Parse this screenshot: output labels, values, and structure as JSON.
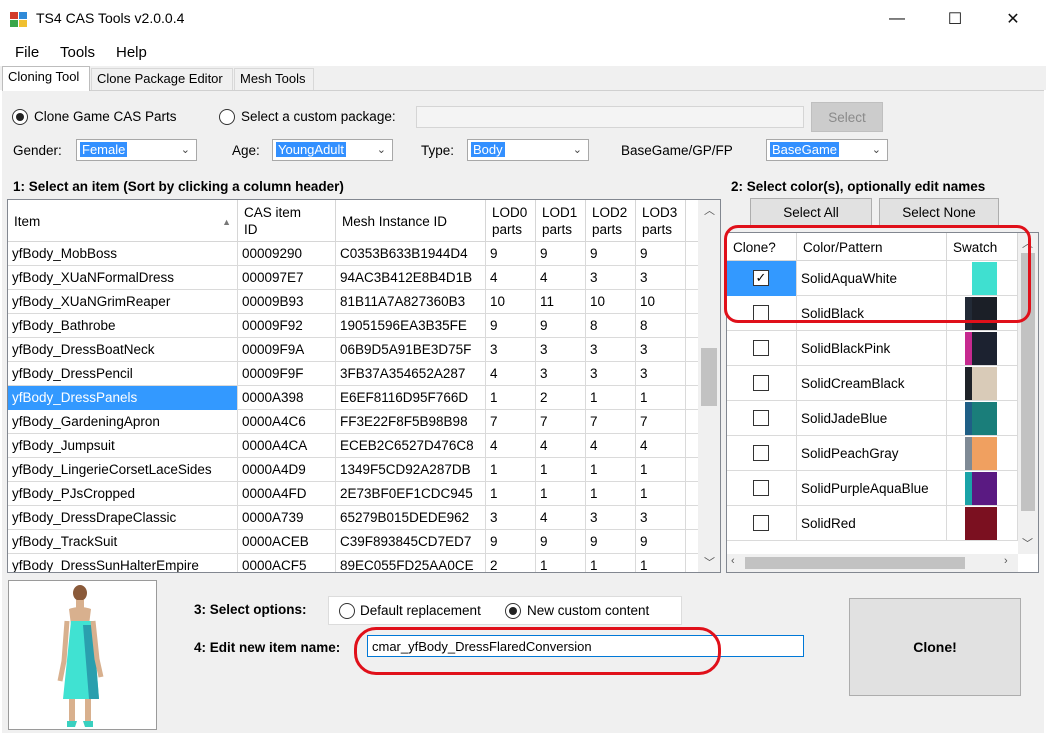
{
  "window": {
    "title": "TS4 CAS Tools v2.0.0.4",
    "minimize": "—",
    "maximize": "☐",
    "close": "✕"
  },
  "menu": {
    "file": "File",
    "tools": "Tools",
    "help": "Help"
  },
  "tabs": [
    "Cloning Tool",
    "Clone Package Editor",
    "Mesh Tools"
  ],
  "source": {
    "clone_game": "Clone Game CAS Parts",
    "custom_package": "Select a custom package:",
    "package_path": "",
    "select_btn": "Select"
  },
  "filters": {
    "gender_label": "Gender:",
    "gender": "Female",
    "age_label": "Age:",
    "age": "YoungAdult",
    "type_label": "Type:",
    "type": "Body",
    "pack_label": "BaseGame/GP/FP",
    "pack": "BaseGame"
  },
  "items": {
    "heading": "1: Select an item (Sort by clicking a column header)",
    "columns": {
      "item": "Item",
      "cas_1": "CAS item",
      "cas_2": "ID",
      "mesh": "Mesh Instance ID",
      "lod0a": "LOD0",
      "lod1a": "LOD1",
      "lod2a": "LOD2",
      "lod3a": "LOD3",
      "parts": "parts"
    },
    "rows": [
      [
        "yfBody_MobBoss",
        "00009290",
        "C0353B633B1944D4",
        "9",
        "9",
        "9",
        "9"
      ],
      [
        "yfBody_XUaNFormalDress",
        "000097E7",
        "94AC3B412E8B4D1B",
        "4",
        "4",
        "3",
        "3"
      ],
      [
        "yfBody_XUaNGrimReaper",
        "00009B93",
        "81B11A7A827360B3",
        "10",
        "11",
        "10",
        "10"
      ],
      [
        "yfBody_Bathrobe",
        "00009F92",
        "19051596EA3B35FE",
        "9",
        "9",
        "8",
        "8"
      ],
      [
        "yfBody_DressBoatNeck",
        "00009F9A",
        "06B9D5A91BE3D75F",
        "3",
        "3",
        "3",
        "3"
      ],
      [
        "yfBody_DressPencil",
        "00009F9F",
        "3FB37A354652A287",
        "4",
        "3",
        "3",
        "3"
      ],
      [
        "yfBody_DressPanels",
        "0000A398",
        "E6EF8116D95F766D",
        "1",
        "2",
        "1",
        "1"
      ],
      [
        "yfBody_GardeningApron",
        "0000A4C6",
        "FF3E22F8F5B98B98",
        "7",
        "7",
        "7",
        "7"
      ],
      [
        "yfBody_Jumpsuit",
        "0000A4CA",
        "ECEB2C6527D476C8",
        "4",
        "4",
        "4",
        "4"
      ],
      [
        "yfBody_LingerieCorsetLaceSides",
        "0000A4D9",
        "1349F5CD92A287DB",
        "1",
        "1",
        "1",
        "1"
      ],
      [
        "yfBody_PJsCropped",
        "0000A4FD",
        "2E73BF0EF1CDC945",
        "1",
        "1",
        "1",
        "1"
      ],
      [
        "yfBody_DressDrapeClassic",
        "0000A739",
        "65279B015DEDE962",
        "3",
        "4",
        "3",
        "3"
      ],
      [
        "yfBody_TrackSuit",
        "0000ACEB",
        "C39F893845CD7ED7",
        "9",
        "9",
        "9",
        "9"
      ],
      [
        "yfBody_DressSunHalterEmpire",
        "0000ACF5",
        "89EC055FD25AA0CE",
        "2",
        "1",
        "1",
        "1"
      ]
    ],
    "selected_index": 6
  },
  "colors": {
    "heading": "2: Select color(s), optionally edit names",
    "select_all": "Select All",
    "select_none": "Select None",
    "columns": {
      "clone": "Clone?",
      "pattern": "Color/Pattern",
      "swatch": "Swatch"
    },
    "rows": [
      {
        "checked": true,
        "name": "SolidAquaWhite",
        "swatch": [
          "#ffffff",
          "#3fe0d0"
        ]
      },
      {
        "checked": false,
        "name": "SolidBlack",
        "swatch": [
          "#222a36",
          "#1b1f27"
        ]
      },
      {
        "checked": false,
        "name": "SolidBlackPink",
        "swatch": [
          "#c62a8f",
          "#1c2230"
        ]
      },
      {
        "checked": false,
        "name": "SolidCreamBlack",
        "swatch": [
          "#1e2228",
          "#d9cbb8"
        ]
      },
      {
        "checked": false,
        "name": "SolidJadeBlue",
        "swatch": [
          "#1f5f86",
          "#1a7e7a"
        ]
      },
      {
        "checked": false,
        "name": "SolidPeachGray",
        "swatch": [
          "#7f8a95",
          "#f0a060"
        ]
      },
      {
        "checked": false,
        "name": "SolidPurpleAquaBlue",
        "swatch": [
          "#1aa3a8",
          "#5a1a82"
        ]
      },
      {
        "checked": false,
        "name": "SolidRed",
        "swatch": [
          "#7b1020",
          "#7b1020"
        ]
      }
    ]
  },
  "options": {
    "heading": "3: Select options:",
    "default_replacement": "Default replacement",
    "new_custom": "New custom content"
  },
  "rename": {
    "heading": "4: Edit new item name:",
    "value": "cmar_yfBody_DressFlaredConversion"
  },
  "clone_btn": "Clone!"
}
